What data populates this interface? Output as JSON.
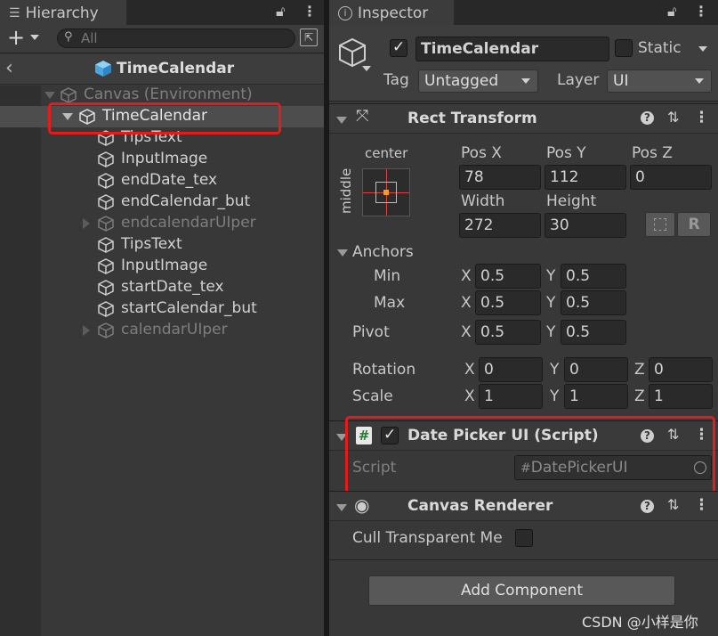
{
  "hierarchy": {
    "tab_label": "Hierarchy",
    "search_placeholder": "All",
    "scene_title": "TimeCalendar",
    "items": [
      {
        "label": "Canvas (Environment)"
      },
      {
        "label": "TimeCalendar"
      },
      {
        "label": "TipsText"
      },
      {
        "label": "InputImage"
      },
      {
        "label": "endDate_tex"
      },
      {
        "label": "endCalendar_but"
      },
      {
        "label": "endcalendarUIper"
      },
      {
        "label": "TipsText"
      },
      {
        "label": "InputImage"
      },
      {
        "label": "startDate_tex"
      },
      {
        "label": "startCalendar_but"
      },
      {
        "label": "calendarUIper"
      }
    ]
  },
  "inspector": {
    "tab_label": "Inspector",
    "object_name": "TimeCalendar",
    "static_label": "Static",
    "tag_label": "Tag",
    "tag_value": "Untagged",
    "layer_label": "Layer",
    "layer_value": "UI",
    "rect_transform": {
      "title": "Rect Transform",
      "anchor_h": "center",
      "anchor_v": "middle",
      "pos_x_label": "Pos X",
      "pos_y_label": "Pos Y",
      "pos_z_label": "Pos Z",
      "pos_x": "78",
      "pos_y": "112",
      "pos_z": "0",
      "width_label": "Width",
      "height_label": "Height",
      "width": "272",
      "height": "30",
      "r_label": "R",
      "anchors_label": "Anchors",
      "min_label": "Min",
      "max_label": "Max",
      "min_x": "0.5",
      "min_y": "0.5",
      "max_x": "0.5",
      "max_y": "0.5",
      "pivot_label": "Pivot",
      "pivot_x": "0.5",
      "pivot_y": "0.5",
      "rotation_label": "Rotation",
      "rot_x": "0",
      "rot_y": "0",
      "rot_z": "0",
      "scale_label": "Scale",
      "scale_x": "1",
      "scale_y": "1",
      "scale_z": "1",
      "x": "X",
      "y": "Y",
      "z": "Z"
    },
    "script_component": {
      "title": "Date Picker UI (Script)",
      "script_label": "Script",
      "script_value": "DatePickerUI"
    },
    "canvas_renderer": {
      "title": "Canvas Renderer",
      "cull_label": "Cull Transparent Me"
    },
    "add_component": "Add Component"
  },
  "watermark": "CSDN @小样是你",
  "colors": {
    "panel_bg": "#383838",
    "highlight": "#e61c1c",
    "cube_blue": "#5fb5ea"
  }
}
